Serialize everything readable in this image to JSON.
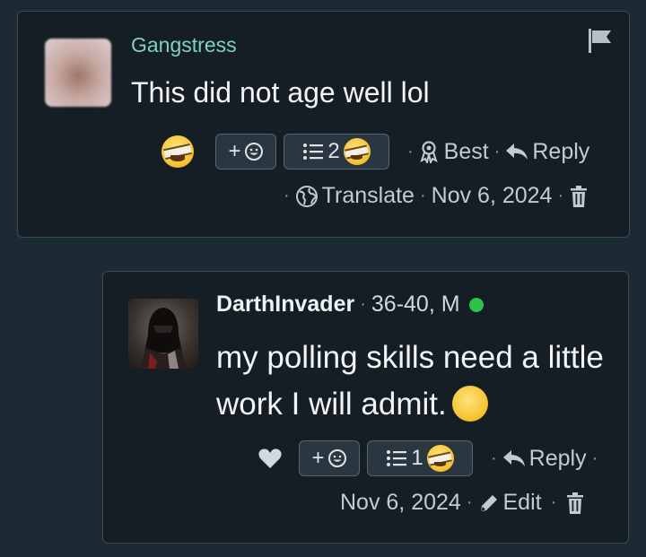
{
  "comment1": {
    "username": "Gangstress",
    "body": "This did not age well lol",
    "add_reaction_label": "+",
    "reaction_count": "2",
    "best_label": "Best",
    "reply_label": "Reply",
    "translate_label": "Translate",
    "date": "Nov 6, 2024"
  },
  "comment2": {
    "username": "DarthInvader",
    "user_info": "36-40, M",
    "body": "my polling skills need a little work I will admit.",
    "add_reaction_label": "+",
    "reaction_count": "1",
    "reply_label": "Reply",
    "date": "Nov 6, 2024",
    "edit_label": "Edit"
  },
  "icons": {
    "flag": "flag-icon",
    "reaction": "laughing-emoji-icon",
    "smiley": "smiley-icon",
    "list": "list-icon",
    "award": "award-icon",
    "reply": "reply-arrow-icon",
    "globe": "globe-icon",
    "trash": "trash-icon",
    "heart": "heart-icon",
    "pencil": "pencil-icon"
  },
  "colors": {
    "background": "#1c2a33",
    "card": "#151e24",
    "username": "#7fd1bf",
    "online": "#2ec24a"
  }
}
